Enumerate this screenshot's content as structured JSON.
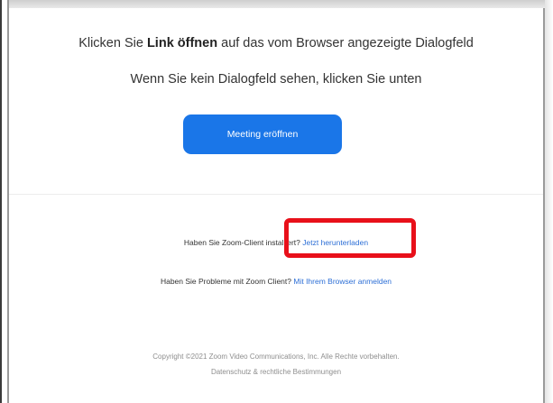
{
  "dialog": {
    "instruction_prefix": "Klicken Sie",
    "instruction_bold": "Link öffnen",
    "instruction_suffix": "auf das vom Browser angezeigte Dialogfeld",
    "subinstruction": "Wenn Sie kein Dialogfeld sehen, klicken Sie unten",
    "launch_button_label": "Meeting eröffnen"
  },
  "help": {
    "installed_question": "Haben Sie Zoom-Client installiert?",
    "download_link": "Jetzt herunterladen",
    "problems_question": "Haben Sie Probleme mit Zoom Client?",
    "browser_link": "Mit Ihrem Browser anmelden"
  },
  "footer": {
    "copyright": "Copyright ©2021 Zoom Video Communications, Inc. Alle Rechte vorbehalten.",
    "legal_link": "Datenschutz & rechtliche Bestimmungen"
  },
  "colors": {
    "button": "#1a76e8",
    "link": "#2d6fd6",
    "highlight": "#e8101a"
  }
}
